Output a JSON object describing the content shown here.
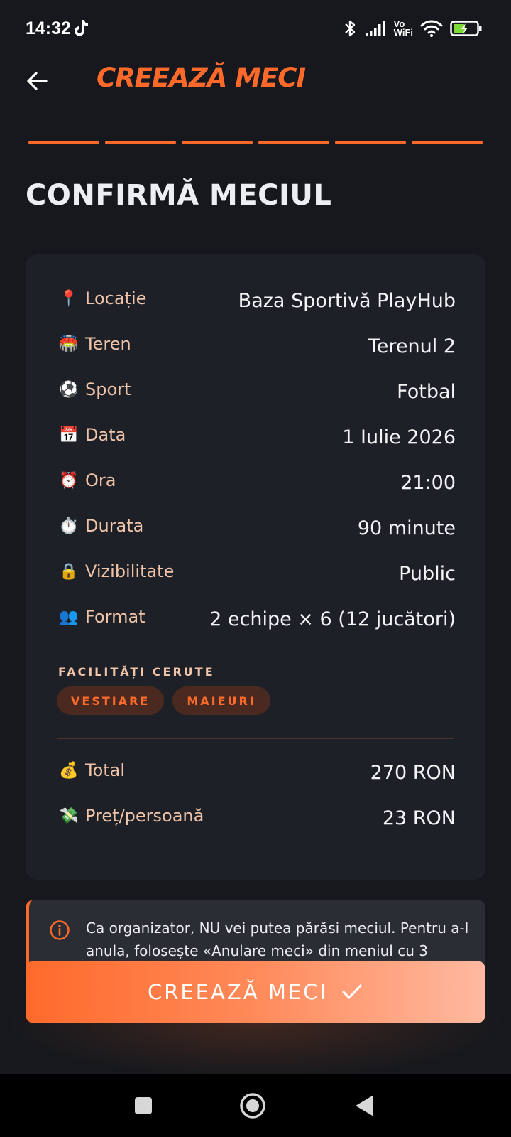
{
  "status_bar": {
    "time": "14:32",
    "volte_line1": "Vo",
    "volte_line2": "WiFi"
  },
  "header": {
    "title": "CREEAZĂ MECI",
    "back_icon": "arrow-left-icon"
  },
  "steps": {
    "total": 6,
    "completed": 6,
    "color": "#ff6a2b"
  },
  "page": {
    "title": "CONFIRMĂ MECIUL"
  },
  "summary": {
    "rows": [
      {
        "icon": "📍",
        "label": "Locație",
        "value": "Baza Sportivă PlayHub"
      },
      {
        "icon": "🏟️",
        "label": "Teren",
        "value": "Terenul 2"
      },
      {
        "icon": "⚽",
        "label": "Sport",
        "value": "Fotbal"
      },
      {
        "icon": "📅",
        "label": "Data",
        "value": "1 Iulie 2026"
      },
      {
        "icon": "⏰",
        "label": "Ora",
        "value": "21:00"
      },
      {
        "icon": "⏱️",
        "label": "Durata",
        "value": "90 minute"
      },
      {
        "icon": "🔒",
        "label": "Vizibilitate",
        "value": "Public"
      },
      {
        "icon": "👥",
        "label": "Format",
        "value": "2 echipe × 6 (12 jucători)"
      }
    ],
    "facilities_label": "FACILITĂȚI CERUTE",
    "facilities": [
      "VESTIARE",
      "MAIEURI"
    ],
    "totals": [
      {
        "icon": "💰",
        "label": "Total",
        "value": "270 RON"
      },
      {
        "icon": "💸",
        "label": "Preț/persoană",
        "value": "23 RON"
      }
    ]
  },
  "info": {
    "icon": "info-circle-icon",
    "text": "Ca organizator, NU vei putea părăsi meciul. Pentru a-l anula, folosește «Anulare meci» din meniul cu 3"
  },
  "cta": {
    "label": "CREEAZĂ MECI",
    "icon": "checkmark-icon"
  },
  "colors": {
    "accent": "#ff6a2b",
    "background": "#16181d",
    "card": "#1e2027",
    "label": "#f0c4a8"
  }
}
